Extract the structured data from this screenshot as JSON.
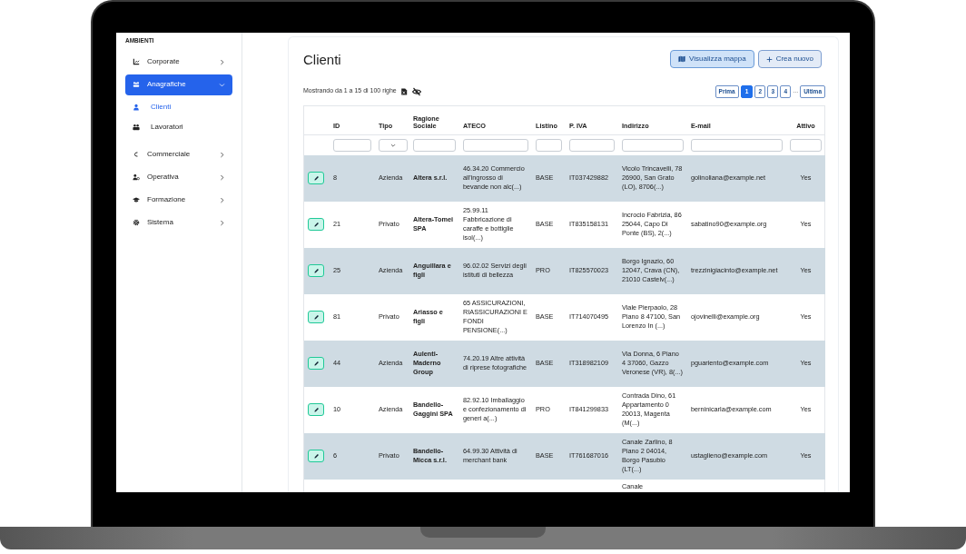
{
  "sidebar": {
    "section": "AMBIENTI",
    "items": [
      {
        "label": "Corporate",
        "expanded": false,
        "selected": false
      },
      {
        "label": "Anagrafiche",
        "expanded": true,
        "selected": true,
        "children": [
          {
            "label": "Clienti",
            "selected": true
          },
          {
            "label": "Lavoratori",
            "selected": false
          }
        ]
      },
      {
        "label": "Commerciale",
        "expanded": false,
        "selected": false
      },
      {
        "label": "Operativa",
        "expanded": false,
        "selected": false
      },
      {
        "label": "Formazione",
        "expanded": false,
        "selected": false
      },
      {
        "label": "Sistema",
        "expanded": false,
        "selected": false
      }
    ]
  },
  "page": {
    "title": "Clienti",
    "buttons": [
      {
        "label": "Visualizza mappa",
        "kind": "map"
      },
      {
        "label": "Crea nuovo",
        "kind": "add"
      }
    ],
    "summary": "Mostrando da 1 a 15 di 100 righe",
    "pagination": [
      {
        "label": "Prima",
        "kind": "page",
        "selected": false
      },
      {
        "label": "1",
        "kind": "page",
        "selected": true
      },
      {
        "label": "2",
        "kind": "page",
        "selected": false
      },
      {
        "label": "3",
        "kind": "page",
        "selected": false
      },
      {
        "label": "4",
        "kind": "page",
        "selected": false
      },
      {
        "label": "...",
        "kind": "gap"
      },
      {
        "label": "Ultima",
        "kind": "page",
        "selected": false
      }
    ]
  },
  "table": {
    "columns": [
      {
        "label": "ID",
        "dropdown_filter": false
      },
      {
        "label": "Tipo",
        "dropdown_filter": true
      },
      {
        "label": "Ragione Sociale",
        "dropdown_filter": false
      },
      {
        "label": "ATECO",
        "dropdown_filter": false
      },
      {
        "label": "Listino",
        "dropdown_filter": false
      },
      {
        "label": "P. IVA",
        "dropdown_filter": false
      },
      {
        "label": "Indirizzo",
        "dropdown_filter": false
      },
      {
        "label": "E-mail",
        "dropdown_filter": false
      },
      {
        "label": "Attivo",
        "dropdown_filter": false
      }
    ],
    "rows": [
      {
        "cells": [
          "8",
          "Azienda",
          "Altera s.r.l.",
          "46.34.20 Commercio all'ingrosso di bevande non alc(...)",
          "BASE",
          "IT037429882",
          "Vicolo Trincavelli, 78 26900, San Grato (LO), 8706(...)",
          "golinoliana@example.net",
          "Yes"
        ]
      },
      {
        "cells": [
          "21",
          "Privato",
          "Altera-Tomei SPA",
          "25.99.11 Fabbricazione di caraffe e bottiglie isol(...)",
          "BASE",
          "IT835158131",
          "Incrocio Fabrizia, 86 25044, Capo Di Ponte (BS), 2(...)",
          "sabatino90@example.org",
          "Yes"
        ]
      },
      {
        "cells": [
          "25",
          "Azienda",
          "Anguillara e figli",
          "96.02.02 Servizi degli istituti di bellezza",
          "PRO",
          "IT825570023",
          "Borgo Ignazio, 60 12047, Crava (CN), 21010 Castelv(...)",
          "trezzinigiacinto@example.net",
          "Yes"
        ]
      },
      {
        "cells": [
          "81",
          "Privato",
          "Ariasso e figli",
          "65 ASSICURAZIONI, RIASSICURAZIONI E FONDI PENSIONE(...)",
          "BASE",
          "IT714070495",
          "Viale Pierpaolo, 28 Piano 8 47100, San Lorenzo In (...)",
          "ojovinelli@example.org",
          "Yes"
        ]
      },
      {
        "cells": [
          "44",
          "Azienda",
          "Aulenti-Maderno Group",
          "74.20.19 Altre attività di riprese fotografiche",
          "BASE",
          "IT318982109",
          "Via Donna, 6 Piano 4 37060, Gazzo Veronese (VR), 8(...)",
          "pguariento@example.com",
          "Yes"
        ]
      },
      {
        "cells": [
          "10",
          "Azienda",
          "Bandello-Gaggini SPA",
          "82.92.10 Imballaggio e confezionamento di generi a(...)",
          "PRO",
          "IT841299833",
          "Contrada Dino, 61 Appartamento 0 20013, Magenta (M(...)",
          "berninicarla@example.com",
          "Yes"
        ]
      },
      {
        "cells": [
          "6",
          "Privato",
          "Bandello-Micca s.r.l.",
          "64.99.30 Attività di merchant bank",
          "BASE",
          "IT761687016",
          "Canale Zarlino, 8 Piano 2 04014, Borgo Pasubio (LT(...)",
          "ustaglieno@example.com",
          "Yes"
        ]
      }
    ],
    "cut_row": {
      "address": "Canale"
    }
  }
}
